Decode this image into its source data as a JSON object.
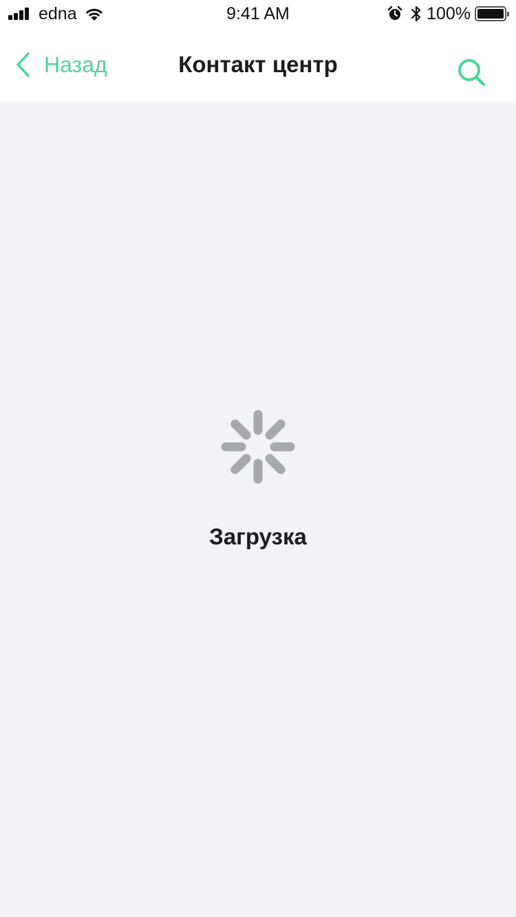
{
  "status_bar": {
    "carrier": "edna",
    "time": "9:41 AM",
    "battery_percent": "100%",
    "battery_level": 1.0,
    "icons": [
      "signal-icon",
      "wifi-icon",
      "alarm-icon",
      "bluetooth-icon",
      "battery-icon"
    ]
  },
  "nav": {
    "back_label": "Назад",
    "title": "Контакт центр",
    "back_icon": "chevron-left-icon",
    "search_icon": "search-icon"
  },
  "loader": {
    "text": "Загрузка",
    "icon": "spinner-icon"
  },
  "colors": {
    "accent": "#4fd49a",
    "background": "#f2f2f7",
    "bar_background": "#ffffff",
    "text_primary": "#1c1c1e",
    "spinner": "#a7aaac"
  }
}
